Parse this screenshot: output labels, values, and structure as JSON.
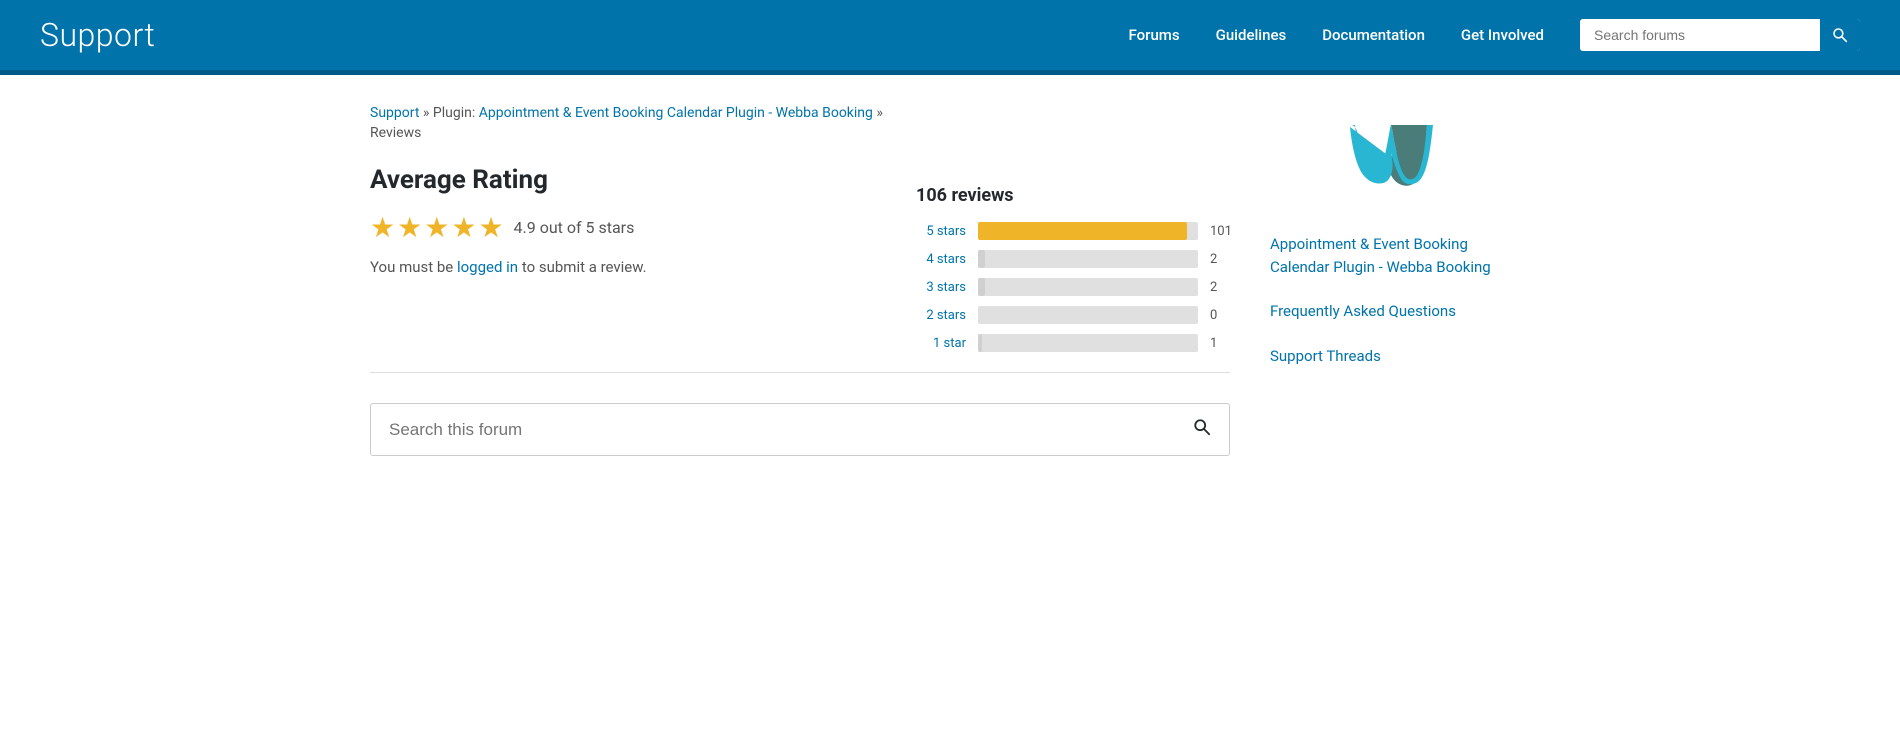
{
  "header": {
    "title": "Support",
    "nav": [
      {
        "label": "Forums",
        "href": "#"
      },
      {
        "label": "Guidelines",
        "href": "#"
      },
      {
        "label": "Documentation",
        "href": "#"
      },
      {
        "label": "Get Involved",
        "href": "#"
      }
    ],
    "search_placeholder": "Search forums"
  },
  "breadcrumb": {
    "support_label": "Support",
    "separator1": " » Plugin: ",
    "plugin_label": "Appointment & Event Booking Calendar Plugin - Webba Booking",
    "separator2": " »",
    "current": "Reviews"
  },
  "rating_section": {
    "heading": "Average Rating",
    "stars_count": 5,
    "rating_text": "4.9 out of 5 stars",
    "login_prompt_pre": "You must be ",
    "login_label": "logged in",
    "login_prompt_post": " to submit a review."
  },
  "reviews": {
    "total_label": "106 reviews",
    "bars": [
      {
        "label": "5 stars",
        "count": 101,
        "percent": 95
      },
      {
        "label": "4 stars",
        "count": 2,
        "percent": 2
      },
      {
        "label": "3 stars",
        "count": 2,
        "percent": 2
      },
      {
        "label": "2 stars",
        "count": 0,
        "percent": 0
      },
      {
        "label": "1 star",
        "count": 1,
        "percent": 1
      }
    ]
  },
  "forum_search": {
    "placeholder": "Search this forum"
  },
  "sidebar": {
    "plugin_link": "Appointment & Event Booking Calendar Plugin - Webba Booking",
    "faq_link": "Frequently Asked Questions",
    "support_link": "Support Threads"
  },
  "icons": {
    "search": "🔍",
    "star": "★"
  }
}
